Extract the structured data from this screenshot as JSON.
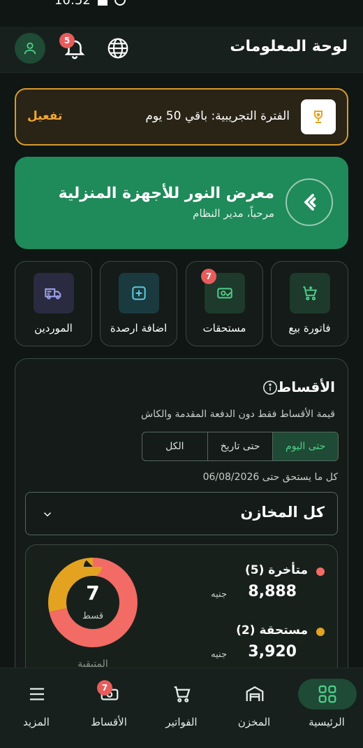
{
  "status_bar": {
    "time": "10:52"
  },
  "header": {
    "title": "لوحة المعلومات",
    "notification_count": "5"
  },
  "trial": {
    "text": "الفترة التجريبية: باقي 50 يوم",
    "action": "تفعيل"
  },
  "store": {
    "name": "معرض النور للأجهزة المنزلية",
    "welcome": "مرحباً، مدير النظام"
  },
  "quick_actions": [
    {
      "label": "فاتورة بيع",
      "icon": "cart-plus-icon"
    },
    {
      "label": "مستحقات",
      "icon": "money-check-icon",
      "badge": "7"
    },
    {
      "label": "اضافة ارصدة",
      "icon": "plus-square-icon"
    },
    {
      "label": "الموردين",
      "icon": "truck-icon"
    }
  ],
  "installments": {
    "title": "الأقساط",
    "description": "قيمة الأقساط فقط دون الدفعة المقدمة والكاش",
    "filters": [
      "حتى اليوم",
      "حتى تاريخ",
      "الكل"
    ],
    "active_filter": "حتى اليوم",
    "due_text": "كل ما يستحق حتى 06/08/2026",
    "warehouse_select": "كل المخازن",
    "summary": {
      "total": "7",
      "unit": "قسط",
      "caption": "المتبقية",
      "overdue": {
        "label": "متأخرة (5)",
        "amount": "8,888",
        "currency": "جنيه",
        "color": "#f26b64",
        "count": 5
      },
      "due": {
        "label": "مستحقة (2)",
        "amount": "3,920",
        "currency": "جنيه",
        "color": "#e3a320",
        "count": 2
      }
    }
  },
  "bottom_nav": [
    {
      "label": "الرئيسية",
      "icon": "grid-icon",
      "active": true
    },
    {
      "label": "المخزن",
      "icon": "warehouse-icon"
    },
    {
      "label": "الفواتير",
      "icon": "cart-icon"
    },
    {
      "label": "الأقساط",
      "icon": "cash-icon",
      "badge": "7"
    },
    {
      "label": "المزيد",
      "icon": "menu-icon"
    }
  ],
  "colors": {
    "accent": "#1f8a5a",
    "background": "#0f1613",
    "warning": "#f0a832",
    "danger": "#e85c5c"
  }
}
